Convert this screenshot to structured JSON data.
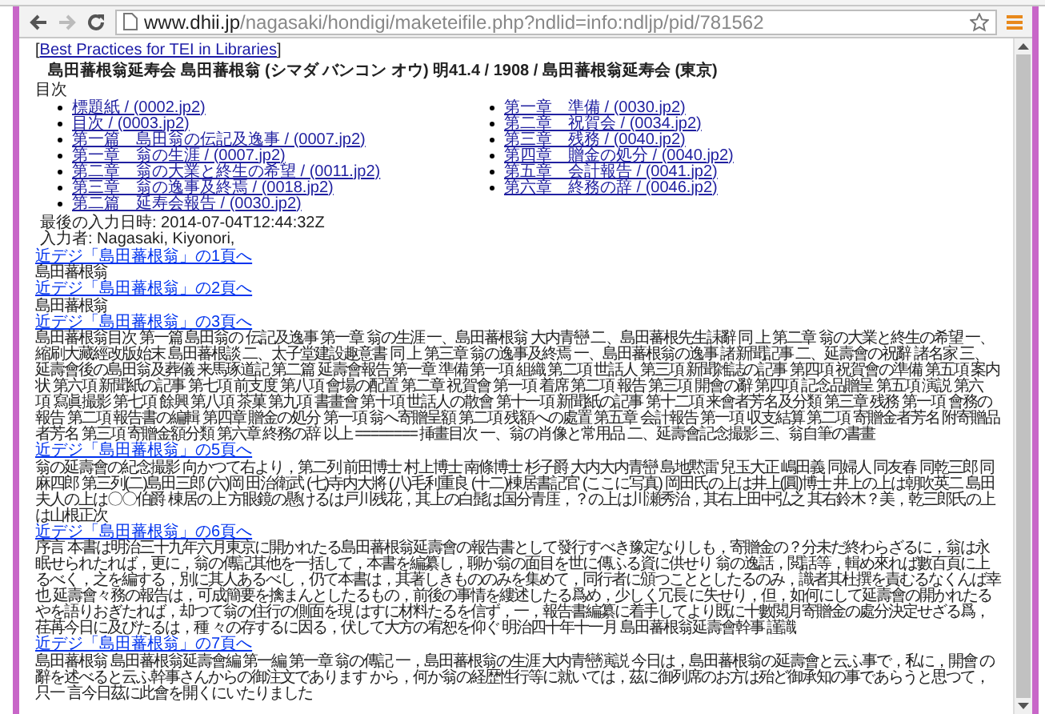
{
  "browser": {
    "url_host": "www.dhii.jp",
    "url_path": "/nagasaki/hondigi/maketeifile.php?ndlid=info:ndljp/pid/781562"
  },
  "header": {
    "open": "[",
    "link": "Best Practices for TEI in Libraries",
    "close": "]"
  },
  "title": "島田蕃根翁延寿会 島田蕃根翁 (シマダ バンコン オウ) 明41.4 / 1908 / 島田蕃根翁延寿会 (東京)",
  "toc_heading": "目次",
  "toc": [
    "標題紙 / (0002.jp2)",
    "目次 / (0003.jp2)",
    "第一篇　島田翁の伝記及逸事 / (0007.jp2)",
    "第一章　翁の生涯 / (0007.jp2)",
    "第二章　翁の大業と終生の希望 / (0011.jp2)",
    "第三章　翁の逸事及終焉 / (0018.jp2)",
    "第二篇　延寿会報告 / (0030.jp2)",
    "第一章　準備 / (0030.jp2)",
    "第二章　祝賀会 / (0034.jp2)",
    "第三章　残務 / (0040.jp2)",
    "第四章　贈金の処分 / (0040.jp2)",
    "第五章　会計報告 / (0041.jp2)",
    "第六章　終務の辞 / (0046.jp2)"
  ],
  "last_modified": "最後の入力日時: 2014-07-04T12:44:32Z",
  "author": "入力者: Nagasaki, Kiyonori,",
  "pages": [
    {
      "link": "近デジ「島田蕃根翁」の1頁へ",
      "text": "島田蕃根翁"
    },
    {
      "link": "近デジ「島田蕃根翁」の2頁へ",
      "text": "島田蕃根翁"
    },
    {
      "link": "近デジ「島田蕃根翁」の3頁へ",
      "text": "島田蕃根翁目次 第一篇 島田翁の 伝記及逸事 第一章 翁の生涯 一、島田蕃根翁 大内青巒 二、島田蕃根先生誄辭 同 上 第二章 翁の大業と終生の希望 一、縮刷大藏經改版始末 島田蕃根談 二、太子堂建設趣意書 同 上 第三章 翁の逸事及終焉 一、島田蕃根翁の逸事 諸新聞記事 二、延壽會の祝辭 諸名家 三、延壽會後の島田翁及葬儀 来馬琢道記 第二篇 延壽會報告 第一章 準備 第一項 組織 第二項 世話人 第三項 新聞雑誌の記事 第四項 祝賀會の準備 第五項 案内状 第六項 新聞紙の記事 第七項 前支度 第八項 會場の配置 第二章 祝賀會 第一項 着席 第二項 報告 第三項 開會の辭 第四項 記念品贈呈 第五項 演説 第六項 寫眞撮影 第七項 餘興 第八項 茶菓 第九項 書畫會 第十項 世話人の散會 第十一項 新聞紙の記事 第十二項 来會者芳名及分類 第三章 残務 第一項 會務の報告 第二項 報告書の編輯 第四章 贈金の処分 第一項 翁へ寄贈呈額 第二項 残額への處置 第五章 会計報告 第一項 収支結算 第二項 寄贈金者芳名 附寄贈品者芳名 第三項 寄贈金額分類 第六章 終務の辞 以上 ======== 挿畫目次 一、翁の肖像と常用品 二、延壽會記念撮影 三、翁自筆の書畫"
    },
    {
      "link": "近デジ「島田蕃根翁」の5頁へ",
      "text": "翁の延壽會の紀念撮影 向かつて右より，第二列 前田博士 村上博士 南條博士 杉子爵 大内大内青巒 島地黙雷 兒玉大正 嶋田義 同婦人 同友春 同乾三郎 同麻四郎 第三列(二)島田三郎 (六)岡 田治衛武 (七)寺内大將 (八)毛利重良 (十二)棟居書記官 (ここに写真) 岡田氏の上は井上(圓)博士 井上の上は朝吹英二 島田夫人の上は〇〇伯爵 棟居の上 方眼鏡の懸けるは戸川残花，其上の白髭は国分青厓，？の上は川瀬秀治，其右上田中弘之 其右鈴木？美，乾三郎氏の上は山根正次"
    },
    {
      "link": "近デジ「島田蕃根翁」の6頁へ",
      "text": "序言 本書は明治三十九年六月東京に開かれたる島田蕃根翁延壽會の報告書として發行すべき豫定なりしも，寄贈金の？分未だ終わらざるに，翁は永眠せられたれば，更に，翁の傳記其他を一括して，本書を編纂し，聊か翁の面目を世に傳ふる資に供せり 翁の逸話，閲話等，輯め來れば數百頁に上るべく，之を編する，別に其人あるべし，仍て本書は，其著しきもののみを集めて，同行者に頒つこととしたるのみ，識者其杜撰を責むるなくんば幸也 延壽會々務の報告は，可成簡要を擒まんとしたるもの，前後の事情を縷述したる爲め，少しく冗長 に失せり，但，如何にして延壽會の開かれたるやを語りおぎたれば，却つて翁の住行の側面を現 はすに材料たるを信ず，一，報告書編纂に着手してより既に十數閲月寄贈金の處分決定せざる爲，荏苒今日に及びたるは，種 々の存するに因る，伏して大方の宥恕を仰ぐ 明治四十年十一月 島田蕃根翁延壽會幹事 謹識"
    },
    {
      "link": "近デジ「島田蕃根翁」の7頁へ",
      "text": "島田蕃根翁 島田蕃根翁延壽會編 第一編 第一章 翁の傳記 一，島田蕃根翁の生涯 大内青巒演説 今日は，島田蕃根翁の延壽會と云ふ事で，私に，開會 の辭を述べると云ふ幹事さんからの御注文であります から，何か翁の経歴性行等に就いては，茲に御列席のお方は殆ど御承知の事であらうと思つて，只一 言今日茲に此會を開くにいたりました"
    }
  ]
}
